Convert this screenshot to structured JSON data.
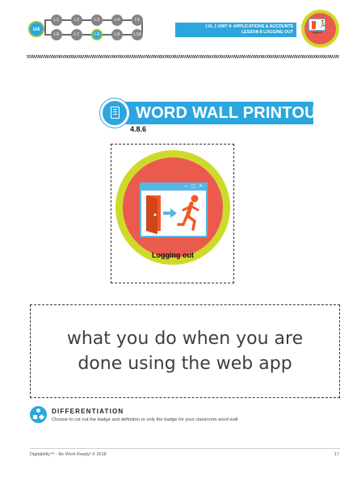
{
  "header": {
    "unit_badge": "U4",
    "lessons_top": [
      "L1",
      "L2",
      "L3",
      "L4",
      "L5"
    ],
    "lessons_bottom": [
      "L6",
      "L7",
      "L8",
      "L9",
      "L10"
    ],
    "current_lesson": "L8",
    "unit_line": "LVL 1 UNIT 4: APPLICATIONS & ACCOUNTS",
    "lesson_line": "LESSON 8 LOGGING OUT",
    "badge_thumb_caption": "Logging out"
  },
  "title": {
    "text": "WORD WALL PRINTOUT",
    "code": "4.8.6",
    "icon": "document-list-icon"
  },
  "badge": {
    "caption": "Logging out",
    "window_controls": "— ▢ ✕",
    "icons": [
      "door-icon",
      "arrow-right-icon",
      "running-person-icon"
    ]
  },
  "definition": {
    "text": "what you do when you are done using the web app"
  },
  "differentiation": {
    "title": "DIFFERENTIATION",
    "text": "Choose to cut out the badge and definition or only the badge for your classroom word wall",
    "icon": "shapes-icon"
  },
  "footer": {
    "left": "Digitability™ - Be Work Ready! © 2018",
    "page_number": "17"
  },
  "colors": {
    "accent_blue": "#2ba6de",
    "badge_lime": "#cfd92a",
    "badge_red": "#ea5a4f",
    "door_orange": "#f05a28",
    "lesson_gray": "#858585"
  }
}
